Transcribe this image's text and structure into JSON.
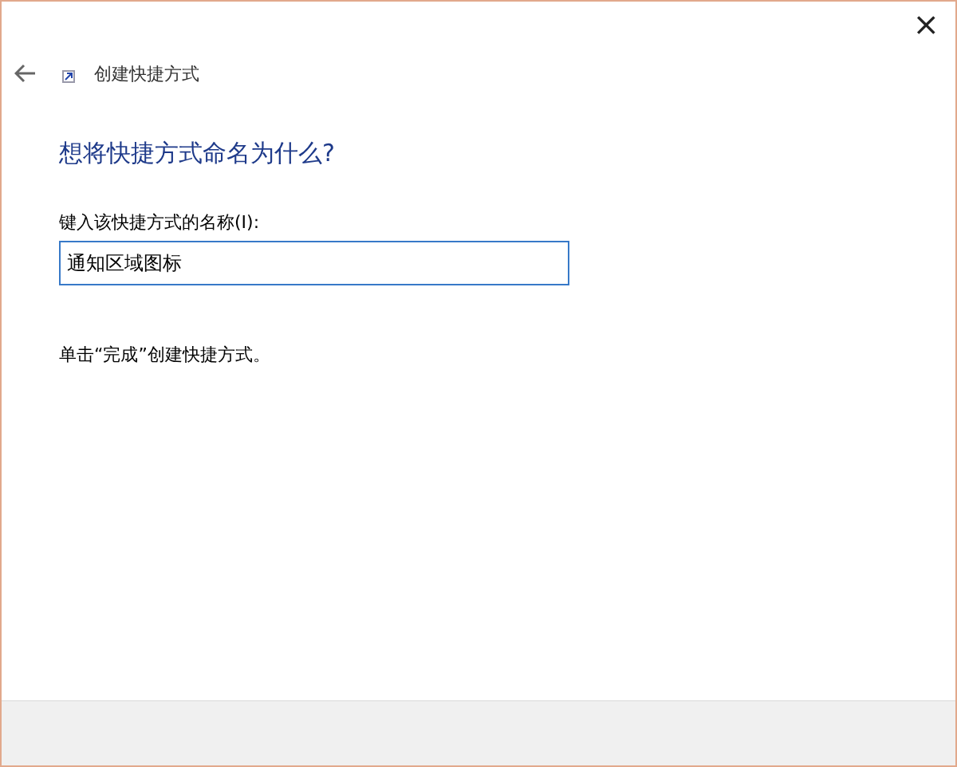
{
  "window": {
    "close": "×",
    "title": "创建快捷方式"
  },
  "heading": "想将快捷方式命名为什么?",
  "name_field": {
    "label": "键入该快捷方式的名称(I):",
    "value": "通知区域图标"
  },
  "hint": "单击“完成”创建快捷方式。"
}
